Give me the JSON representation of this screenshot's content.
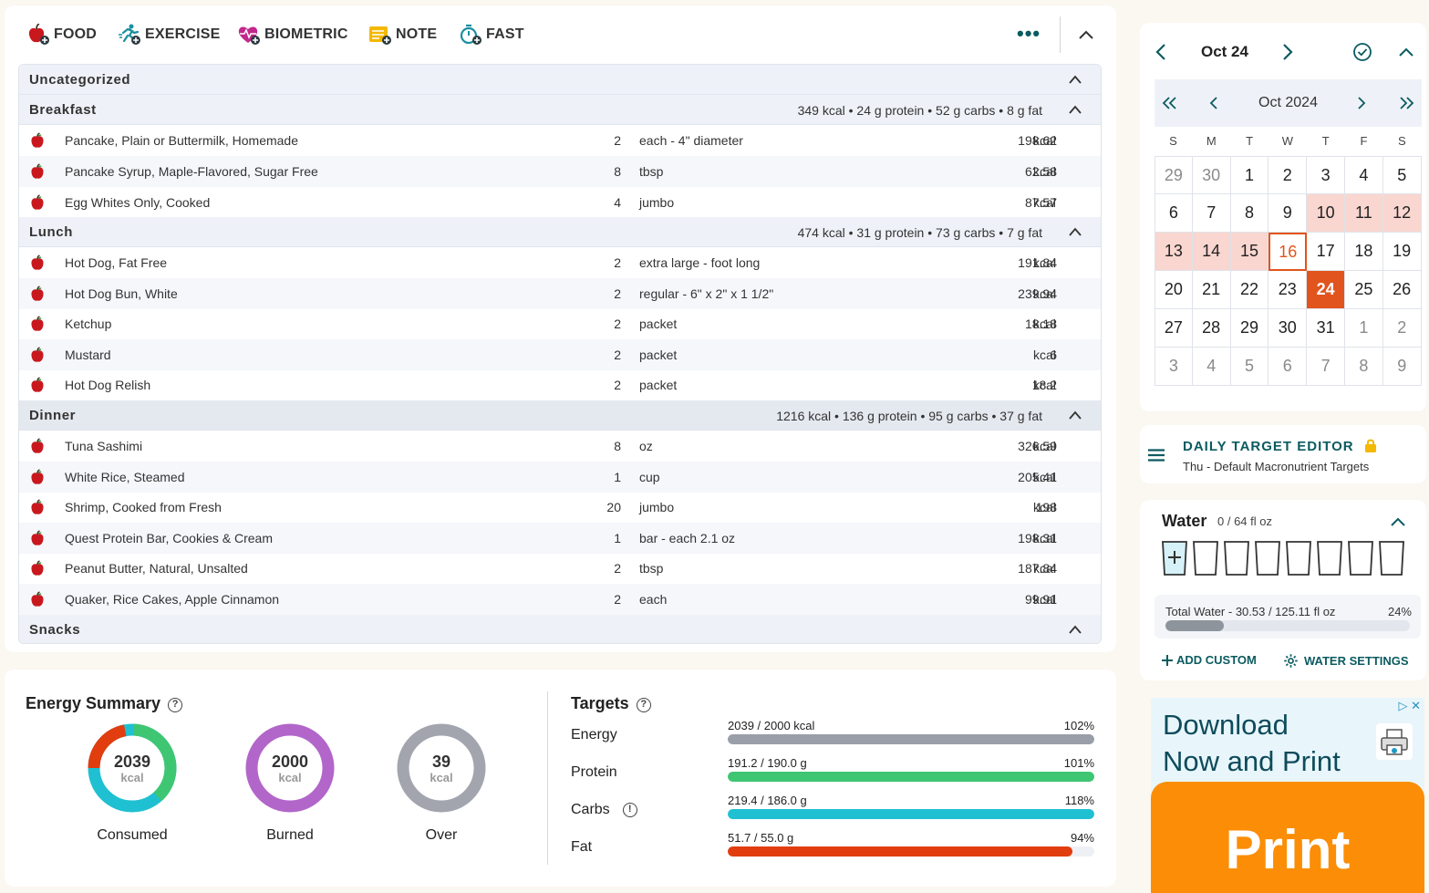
{
  "toolbar": {
    "food": "FOOD",
    "exercise": "EXERCISE",
    "biometric": "BIOMETRIC",
    "note": "NOTE",
    "fast": "FAST",
    "more": "•••"
  },
  "diary": {
    "uncategorized": "Uncategorized",
    "breakfast": {
      "name": "Breakfast",
      "macros": "349 kcal • 24 g protein • 52 g carbs • 8 g fat",
      "items": [
        {
          "name": "Pancake, Plain or Buttermilk, Homemade",
          "qty": "2",
          "unit": "each - 4\" diameter",
          "kcal": "198.62",
          "ku": "kcal"
        },
        {
          "name": "Pancake Syrup, Maple-Flavored, Sugar Free",
          "qty": "8",
          "unit": "tbsp",
          "kcal": "62.58",
          "ku": "kcal"
        },
        {
          "name": "Egg Whites Only, Cooked",
          "qty": "4",
          "unit": "jumbo",
          "kcal": "87.57",
          "ku": "kcal"
        }
      ]
    },
    "lunch": {
      "name": "Lunch",
      "macros": "474 kcal • 31 g protein • 73 g carbs • 7 g fat",
      "items": [
        {
          "name": "Hot Dog, Fat Free",
          "qty": "2",
          "unit": "extra large - foot long",
          "kcal": "191.84",
          "ku": "kcal"
        },
        {
          "name": "Hot Dog Bun, White",
          "qty": "2",
          "unit": "regular - 6\" x 2\" x 1 1/2\"",
          "kcal": "239.94",
          "ku": "kcal"
        },
        {
          "name": "Ketchup",
          "qty": "2",
          "unit": "packet",
          "kcal": "18.18",
          "ku": "kcal"
        },
        {
          "name": "Mustard",
          "qty": "2",
          "unit": "packet",
          "kcal": "6",
          "ku": "kcal"
        },
        {
          "name": "Hot Dog Relish",
          "qty": "2",
          "unit": "packet",
          "kcal": "18.2",
          "ku": "kcal"
        }
      ]
    },
    "dinner": {
      "name": "Dinner",
      "macros": "1216 kcal • 136 g protein • 95 g carbs • 37 g fat",
      "items": [
        {
          "name": "Tuna Sashimi",
          "qty": "8",
          "unit": "oz",
          "kcal": "326.59",
          "ku": "kcal"
        },
        {
          "name": "White Rice, Steamed",
          "qty": "1",
          "unit": "cup",
          "kcal": "205.41",
          "ku": "kcal"
        },
        {
          "name": "Shrimp, Cooked from Fresh",
          "qty": "20",
          "unit": "jumbo",
          "kcal": "198",
          "ku": "kcal"
        },
        {
          "name": "Quest Protein Bar, Cookies & Cream",
          "qty": "1",
          "unit": "bar - each 2.1 oz",
          "kcal": "198.31",
          "ku": "kcal"
        },
        {
          "name": "Peanut Butter, Natural, Unsalted",
          "qty": "2",
          "unit": "tbsp",
          "kcal": "187.84",
          "ku": "kcal"
        },
        {
          "name": "Quaker, Rice Cakes, Apple Cinnamon",
          "qty": "2",
          "unit": "each",
          "kcal": "99.91",
          "ku": "kcal"
        }
      ]
    },
    "snacks": "Snacks"
  },
  "energy": {
    "title": "Energy Summary",
    "help": "?",
    "consumed": {
      "value": "2039",
      "unit": "kcal",
      "label": "Consumed"
    },
    "burned": {
      "value": "2000",
      "unit": "kcal",
      "label": "Burned"
    },
    "over": {
      "value": "39",
      "unit": "kcal",
      "label": "Over"
    }
  },
  "targets": {
    "title": "Targets",
    "help": "?",
    "energy": {
      "name": "Energy",
      "value": "2039 / 2000 kcal",
      "pct": "102%",
      "fill": 1.0,
      "color": "#9a9ea8"
    },
    "protein": {
      "name": "Protein",
      "value": "191.2 / 190.0 g",
      "pct": "101%",
      "fill": 1.0,
      "color": "#3ec672"
    },
    "carbs": {
      "name": "Carbs",
      "value": "219.4 / 186.0 g",
      "pct": "118%",
      "fill": 1.0,
      "color": "#1fc0d1",
      "info": "!"
    },
    "fat": {
      "name": "Fat",
      "value": "51.7 / 55.0 g",
      "pct": "94%",
      "fill": 0.94,
      "color": "#e23d0f"
    }
  },
  "calendar": {
    "title": "Oct 24",
    "month": "Oct 2024",
    "dows": [
      "S",
      "M",
      "T",
      "W",
      "T",
      "F",
      "S"
    ],
    "weeks": [
      [
        "29",
        "30",
        "1",
        "2",
        "3",
        "4",
        "5"
      ],
      [
        "6",
        "7",
        "8",
        "9",
        "10",
        "11",
        "12"
      ],
      [
        "13",
        "14",
        "15",
        "16",
        "17",
        "18",
        "19"
      ],
      [
        "20",
        "21",
        "22",
        "23",
        "24",
        "25",
        "26"
      ],
      [
        "27",
        "28",
        "29",
        "30",
        "31",
        "1",
        "2"
      ],
      [
        "3",
        "4",
        "5",
        "6",
        "7",
        "8",
        "9"
      ]
    ]
  },
  "target_editor": {
    "title": "DAILY TARGET EDITOR",
    "subtitle": "Thu - Default Macronutrient Targets"
  },
  "water": {
    "title": "Water",
    "amount": "0 / 64 fl oz",
    "total": "Total Water - 30.53 / 125.11 fl oz",
    "pct": "24%",
    "fill": 0.24,
    "add_custom": "ADD CUSTOM",
    "settings": "WATER SETTINGS"
  },
  "ad": {
    "line1": "Download",
    "line2": "Now and Print",
    "button": "Print"
  },
  "colors": {
    "accent": "#0b5b60",
    "orange": "#e2541d",
    "pink": "#f9d6cf"
  }
}
